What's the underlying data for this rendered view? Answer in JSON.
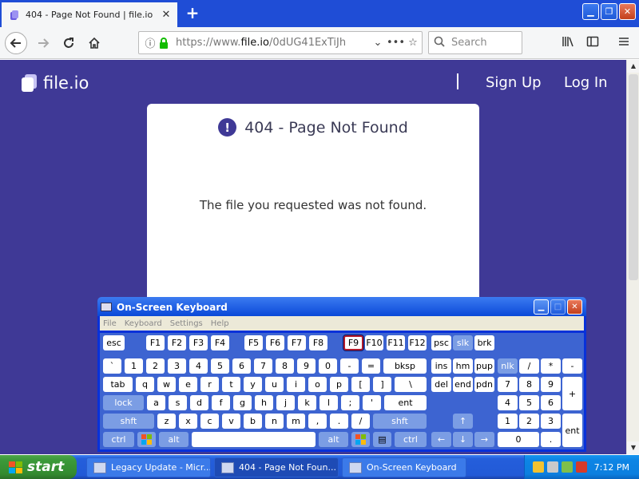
{
  "browser": {
    "tab_title": "404 - Page Not Found | file.io",
    "url_prefix": "https://www.",
    "url_host": "file.io",
    "url_path": "/0dUG41ExTiJh",
    "search_placeholder": "Search"
  },
  "page": {
    "logo_text": "file.io",
    "nav": {
      "signup": "Sign Up",
      "login": "Log In"
    },
    "error_title": "404 - Page Not Found",
    "error_message": "The file you requested was not found.",
    "background_color": "#3f3996"
  },
  "osk": {
    "title": "On-Screen Keyboard",
    "menu": [
      "File",
      "Keyboard",
      "Settings",
      "Help"
    ],
    "pressed_key": "F9"
  },
  "taskbar": {
    "start_label": "start",
    "tasks": [
      {
        "label": "Legacy Update - Micr..."
      },
      {
        "label": "404 - Page Not Foun..."
      },
      {
        "label": "On-Screen Keyboard"
      }
    ],
    "clock": "7:12 PM"
  }
}
